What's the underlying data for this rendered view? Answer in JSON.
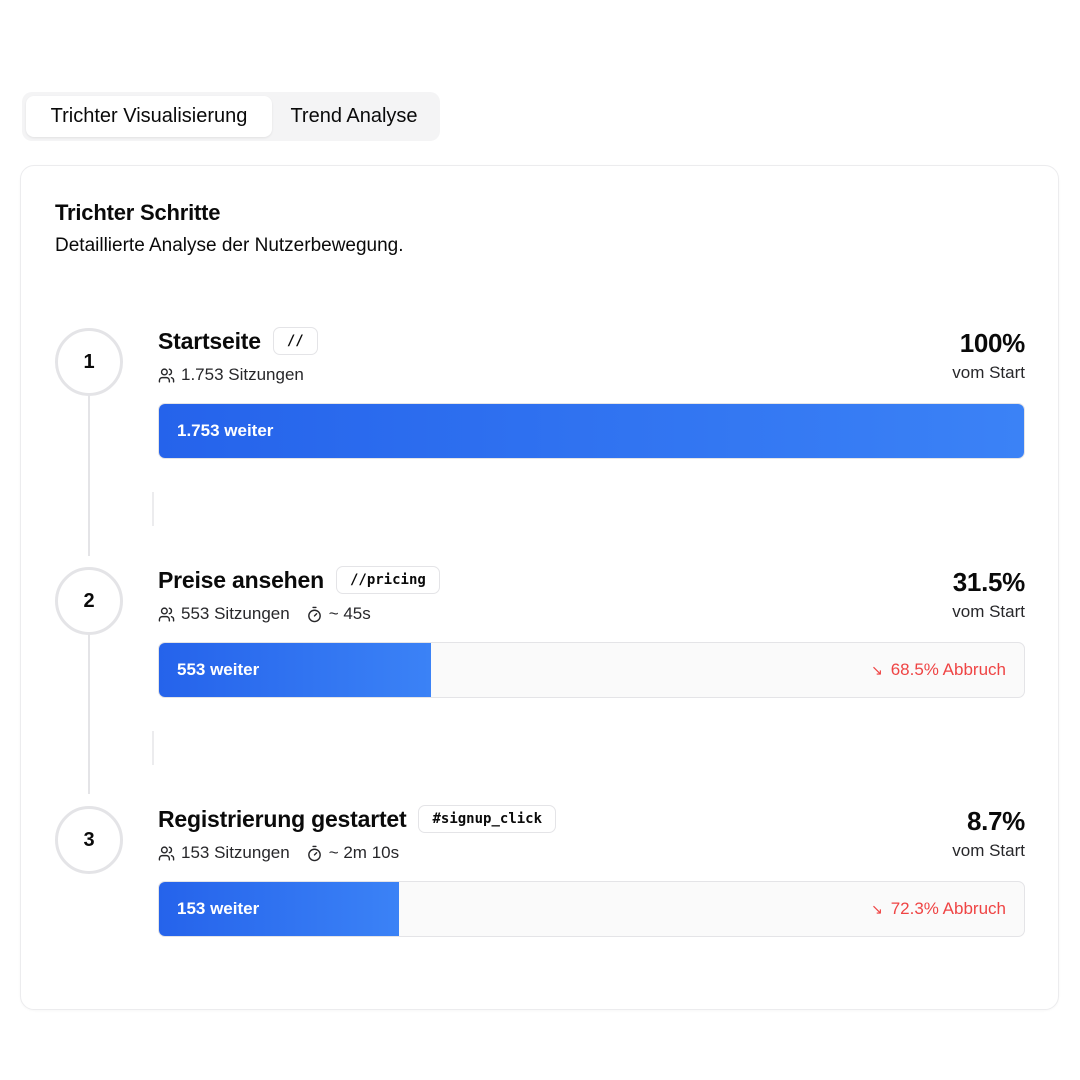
{
  "tabs": [
    {
      "label": "Trichter Visualisierung",
      "active": true
    },
    {
      "label": "Trend Analyse",
      "active": false
    }
  ],
  "card": {
    "title": "Trichter Schritte",
    "subtitle": "Detaillierte Analyse der Nutzerbewegung."
  },
  "steps": [
    {
      "number": "1",
      "name": "Startseite",
      "tag": "//",
      "sessions": "1.753 Sitzungen",
      "duration": "",
      "percent": "100%",
      "percent_label": "vom Start",
      "bar_label": "1.753 weiter",
      "fill_fraction": 1.0,
      "dropoff": ""
    },
    {
      "number": "2",
      "name": "Preise ansehen",
      "tag": "//pricing",
      "sessions": "553 Sitzungen",
      "duration": "~ 45s",
      "percent": "31.5%",
      "percent_label": "vom Start",
      "bar_label": "553 weiter",
      "fill_fraction": 0.315,
      "dropoff": "68.5% Abbruch"
    },
    {
      "number": "3",
      "name": "Registrierung gestartet",
      "tag": "#signup_click",
      "sessions": "153 Sitzungen",
      "duration": "~ 2m 10s",
      "percent": "8.7%",
      "percent_label": "vom Start",
      "bar_label": "153 weiter",
      "fill_fraction": 0.277,
      "dropoff": "72.3% Abbruch"
    }
  ],
  "icons": {
    "sessions": "users-icon",
    "duration": "timer-icon",
    "dropoff": "arrow-down-right-icon"
  },
  "colors": {
    "bar_start": "#2563eb",
    "bar_end": "#3b82f6",
    "dropoff": "#ef4444"
  }
}
